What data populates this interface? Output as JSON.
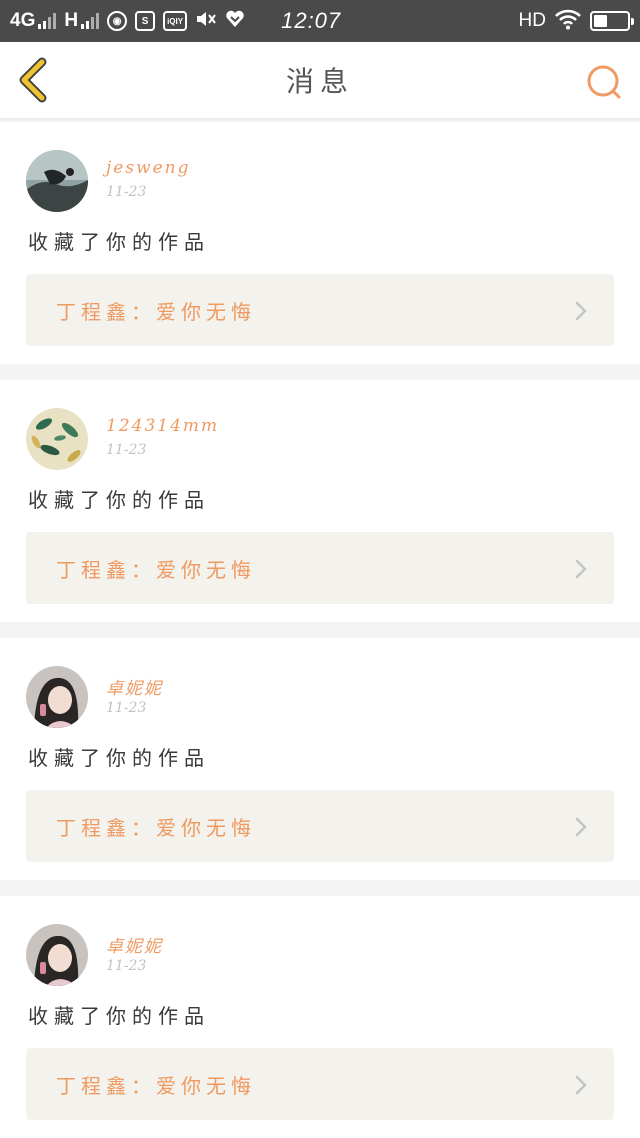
{
  "status_bar": {
    "network_1": "4G",
    "network_2": "H",
    "app_icons": [
      "browser-icon",
      "s-app-icon",
      "iqiyi-icon",
      "mute-icon",
      "vpn-heart-icon"
    ],
    "app_labels": [
      "",
      "S",
      "iQIY",
      "",
      ""
    ],
    "time": "12:07",
    "hd": "HD",
    "battery_level": 0.4
  },
  "header": {
    "title": "消息"
  },
  "colors": {
    "accent": "#ef9a62",
    "back_arrow": "#f1c232",
    "box_bg": "#f3f2ec"
  },
  "messages": [
    {
      "username": "jesweng",
      "date": "11-23",
      "action": "收藏了你的作品",
      "work": "丁程鑫：爱你无悔",
      "avatar": "avatar-dark-landscape"
    },
    {
      "username": "124314mm",
      "date": "11-23",
      "action": "收藏了你的作品",
      "work": "丁程鑫：爱你无悔",
      "avatar": "avatar-leaves"
    },
    {
      "username": "卓妮妮",
      "date": "11-23",
      "action": "收藏了你的作品",
      "work": "丁程鑫：爱你无悔",
      "avatar": "avatar-girl"
    },
    {
      "username": "卓妮妮",
      "date": "11-23",
      "action": "收藏了你的作品",
      "work": "丁程鑫：爱你无悔",
      "avatar": "avatar-girl"
    }
  ]
}
